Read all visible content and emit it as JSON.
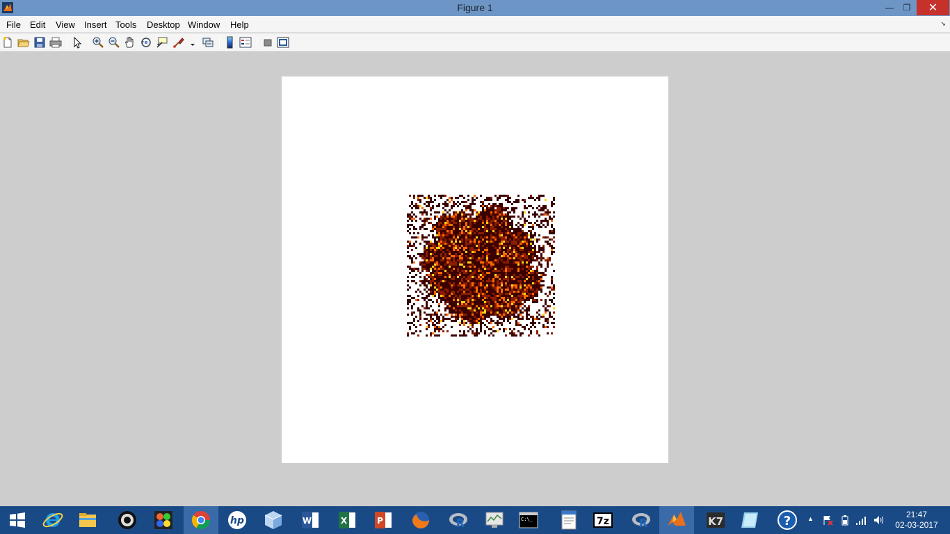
{
  "window": {
    "title": "Figure 1",
    "minimize_glyph": "—",
    "restore_glyph": "❐",
    "close_glyph": "✕"
  },
  "menu": {
    "items": [
      "File",
      "Edit",
      "View",
      "Insert",
      "Tools",
      "Desktop",
      "Window",
      "Help"
    ],
    "overflow_glyph": "➘"
  },
  "toolbar": {
    "buttons": [
      "new-figure-icon",
      "open-file-icon",
      "save-icon",
      "print-icon",
      "edit-plot-arrow-icon",
      "zoom-in-icon",
      "zoom-out-icon",
      "pan-hand-icon",
      "rotate-3d-icon",
      "data-cursor-icon",
      "brush-icon",
      "link-plot-icon",
      "insert-colorbar-icon",
      "insert-legend-icon",
      "hide-plot-tools-icon",
      "show-plot-tools-icon"
    ]
  },
  "figure": {
    "colormap": "hot",
    "colors": {
      "dark": "#3a0000",
      "mid": "#8a1d00",
      "bright": "#ff6a00",
      "yellow": "#ffd21a"
    }
  },
  "taskbar": {
    "apps": [
      "windows-start-icon",
      "internet-explorer-icon",
      "file-explorer-icon",
      "camera-app-icon",
      "photo-app-icon",
      "chrome-icon",
      "hp-icon",
      "cube-app-icon",
      "word-icon",
      "excel-icon",
      "powerpoint-icon",
      "firefox-icon",
      "r-icon",
      "resource-monitor-icon",
      "command-prompt-icon",
      "text-editor-icon",
      "7zip-icon",
      "r-studio-icon",
      "matlab-icon",
      "k7-antivirus-icon",
      "glass-app-icon",
      "help-icon"
    ],
    "tray_chevron": "▲",
    "clock_time": "21:47",
    "clock_date": "02-03-2017"
  }
}
